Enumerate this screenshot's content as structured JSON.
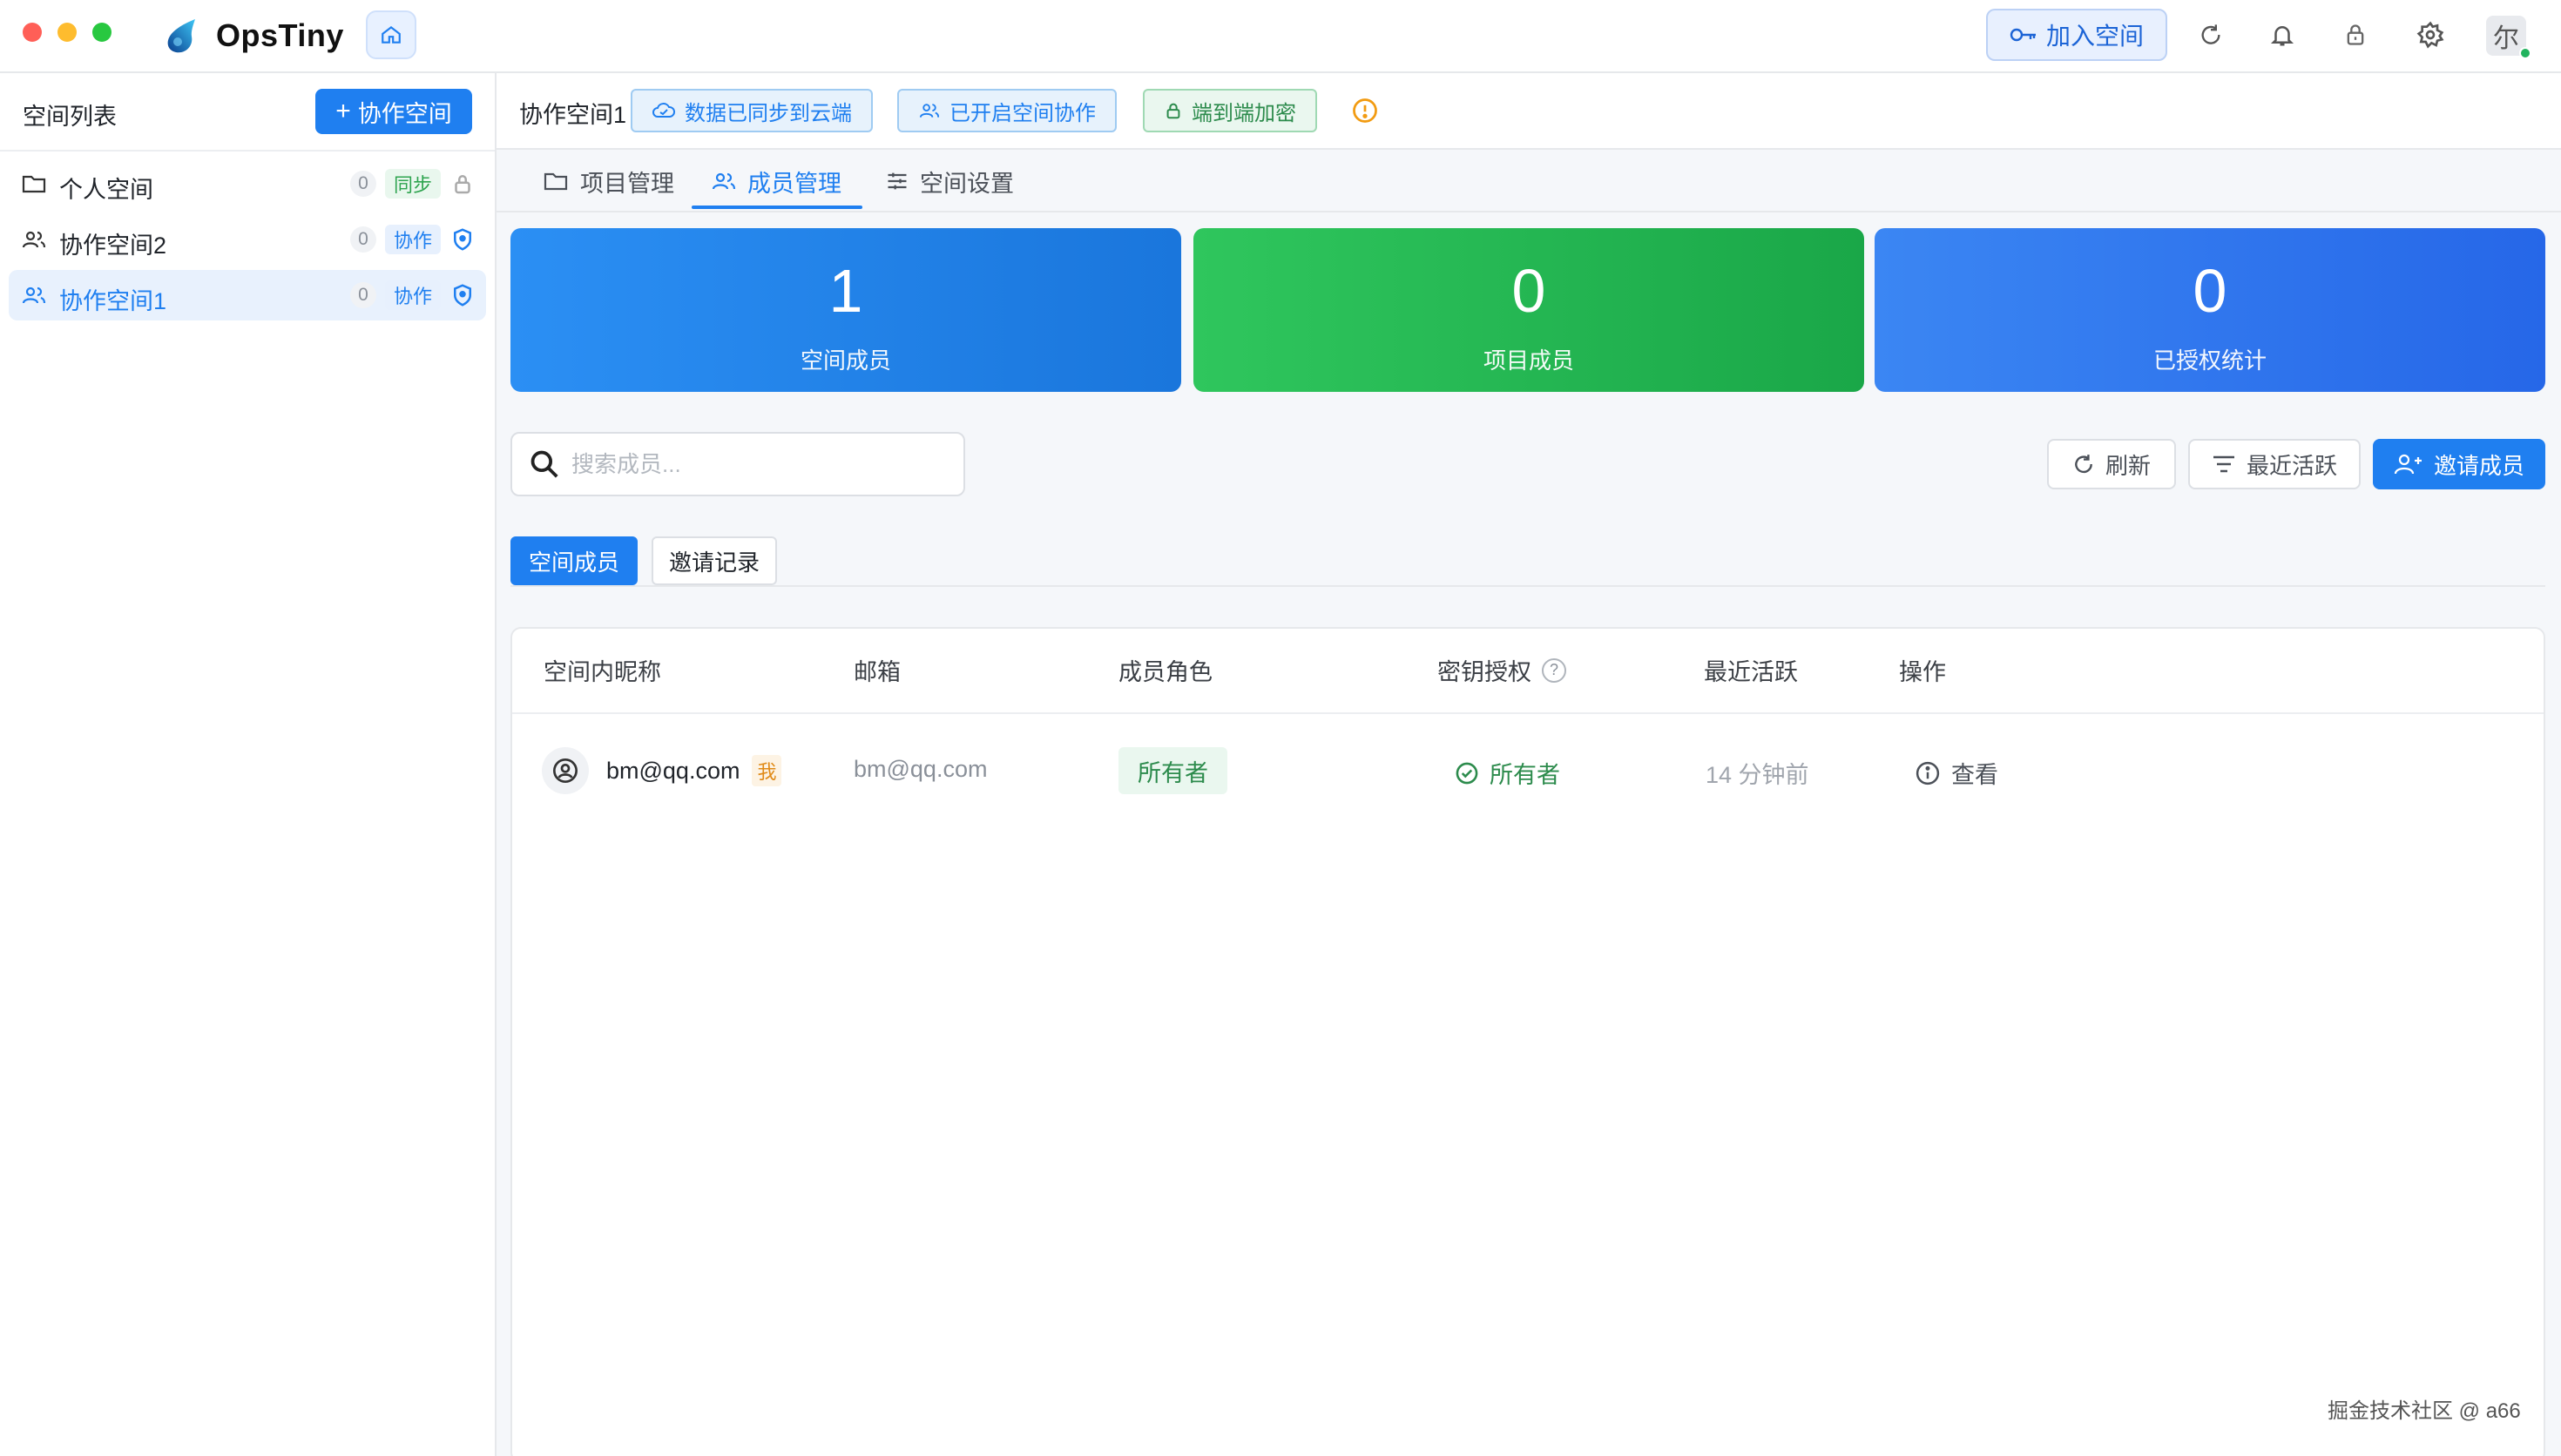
{
  "window": {
    "app_title": "OpsTiny",
    "join_space_label": "加入空间",
    "avatar_text": "尔",
    "colors": {
      "close": "#ff5f57",
      "minimize": "#febc2e",
      "maximize": "#28c840",
      "accent": "#1f7ff0"
    }
  },
  "sidebar": {
    "title": "空间列表",
    "add_button": "协作空间",
    "items": [
      {
        "label": "个人空间",
        "count": "0",
        "tag": "同步",
        "icon": "folder-icon",
        "end_icon": "lock-icon"
      },
      {
        "label": "协作空间2",
        "count": "0",
        "tag": "协作",
        "icon": "users-icon",
        "end_icon": "shield-icon"
      },
      {
        "label": "协作空间1",
        "count": "0",
        "tag": "协作",
        "icon": "users-icon",
        "end_icon": "shield-icon"
      }
    ]
  },
  "workspace": {
    "name": "协作空间1",
    "chips": [
      "数据已同步到云端",
      "已开启空间协作",
      "端到端加密"
    ]
  },
  "tabs": [
    {
      "label": "项目管理",
      "icon": "folder-icon"
    },
    {
      "label": "成员管理",
      "icon": "users-icon"
    },
    {
      "label": "空间设置",
      "icon": "sliders-icon"
    }
  ],
  "stats": [
    {
      "value": "1",
      "label": "空间成员",
      "color": "#2b8ff4"
    },
    {
      "value": "0",
      "label": "项目成员",
      "color": "#2fc65d"
    },
    {
      "value": "0",
      "label": "已授权统计",
      "color": "#3b86f3"
    }
  ],
  "toolbar": {
    "search_placeholder": "搜索成员...",
    "refresh": "刷新",
    "sort": "最近活跃",
    "invite": "邀请成员"
  },
  "subtabs": [
    "空间成员",
    "邀请记录"
  ],
  "table": {
    "columns": [
      "空间内昵称",
      "邮箱",
      "成员角色",
      "密钥授权",
      "最近活跃",
      "操作"
    ],
    "rows": [
      {
        "nickname": "bm@qq.com",
        "me": "我",
        "email": "bm@qq.com",
        "role": "所有者",
        "key_auth": "所有者",
        "last_active": "14 分钟前",
        "action": "查看"
      }
    ]
  },
  "watermark": "掘金技术社区 @ a66"
}
